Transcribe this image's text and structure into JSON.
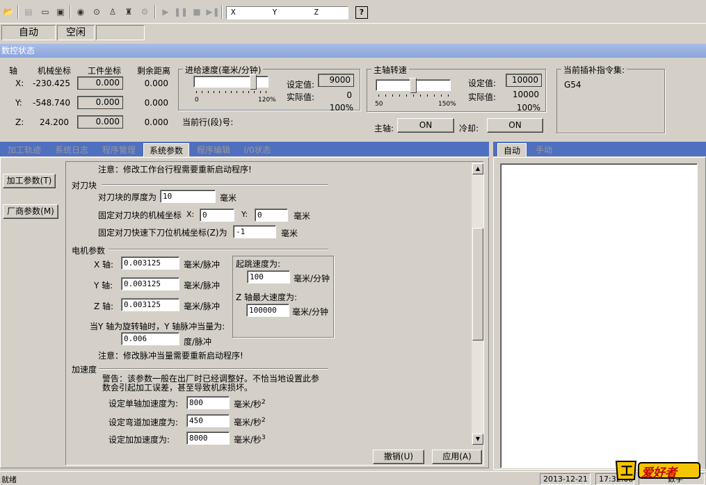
{
  "toolbar": {
    "coords_text": "X        Y        Z",
    "help_label": "?",
    "icons": [
      "open-icon",
      "new-program-icon",
      "window-icon",
      "program-view-icon",
      "sensor-icon",
      "probe-icon",
      "spindle-icon",
      "coolant-icon",
      "tool-icon",
      "run-icon",
      "pause-icon",
      "stop-icon",
      "step-icon"
    ]
  },
  "mode": {
    "run_mode": "自动",
    "state": "空闲"
  },
  "cnc_status": {
    "title": "数控状态",
    "headers": {
      "axis": "轴",
      "machine": "机械坐标",
      "work": "工件坐标",
      "remaining": "剩余距离"
    },
    "axes": [
      {
        "label": "X:",
        "machine": "-230.425",
        "work": "0.000",
        "remaining": "0.000"
      },
      {
        "label": "Y:",
        "machine": "-548.740",
        "work": "0.000",
        "remaining": "0.000"
      },
      {
        "label": "Z:",
        "machine": "24.200",
        "work": "0.000",
        "remaining": "0.000"
      }
    ],
    "feed": {
      "title": "进给速度(毫米/分钟)",
      "min_label": "0",
      "max_label": "120%",
      "set_label": "设定值:",
      "set_value": "9000",
      "actual_label": "实际值:",
      "actual_value": "0",
      "percent": "100%",
      "slider_level": 0.83
    },
    "current_line_label": "当前行(段)号:",
    "spindle": {
      "title": "主轴转速",
      "min_label": "50",
      "max_label": "150%",
      "set_label": "设定值:",
      "set_value": "10000",
      "actual_label": "实际值:",
      "actual_value": "10000",
      "percent": "100%",
      "slider_level": 0.5
    },
    "spindle_btn_label": "主轴:",
    "spindle_btn": "ON",
    "coolant_btn_label": "冷却:",
    "coolant_btn": "ON",
    "interp": {
      "title": "当前插补指令集:",
      "value": "G54"
    }
  },
  "left_tabs": [
    {
      "label": "加工轨迹",
      "active": false
    },
    {
      "label": "系统日志",
      "active": false
    },
    {
      "label": "程序管理",
      "active": false
    },
    {
      "label": "系统参数",
      "active": true
    },
    {
      "label": "程序编辑",
      "active": false
    },
    {
      "label": "I/0状态",
      "active": false
    }
  ],
  "side_buttons": {
    "process": "加工参数(T)",
    "vendor": "厂商参数(M)"
  },
  "params": {
    "notice_travel": "注意：修改工作台行程需要重新启动程序!",
    "tool_block": {
      "title": "对刀块",
      "thickness_label": "对刀块的厚度为",
      "thickness": "10",
      "thickness_unit": "毫米",
      "fixed_label": "固定对刀块的机械坐标",
      "x_label": "X:",
      "x_value": "0",
      "y_label": "Y:",
      "y_value": "0",
      "fixed_unit": "毫米",
      "fast_label": "固定对刀快速下刀位机械坐标(Z)为",
      "fast_value": "-1",
      "fast_unit": "毫米"
    },
    "motor": {
      "title": "电机参数",
      "x_label": "X 轴:",
      "x_value": "0.003125",
      "x_unit": "毫米/脉冲",
      "y_label": "Y 轴:",
      "y_value": "0.003125",
      "y_unit": "毫米/脉冲",
      "z_label": "Z 轴:",
      "z_value": "0.003125",
      "z_unit": "毫米/脉冲",
      "rotary_label": "当Y 轴为旋转轴时，Y 轴脉冲当量为:",
      "rotary_value": "0.006",
      "rotary_unit": "度/脉冲",
      "jump_label": "起跳速度为:",
      "jump_value": "100",
      "jump_unit": "毫米/分钟",
      "zmax_label": "Z 轴最大速度为:",
      "zmax_value": "100000",
      "zmax_unit": "毫米/分钟",
      "notice": "注意：修改脉冲当量需要重新启动程序!"
    },
    "accel": {
      "title": "加速度",
      "warn1": "警告：该参数一般在出厂时已经调整好。不恰当地设置此参",
      "warn2": "数会引起加工误差，甚至导致机床损坏。",
      "single_label": "设定单轴加速度为:",
      "single_value": "800",
      "single_unit": "毫米/秒",
      "single_sup": "2",
      "curve_label": "设定弯道加速度为:",
      "curve_value": "450",
      "curve_unit": "毫米/秒",
      "curve_sup": "2",
      "jerk_label": "设定加加速度为:",
      "jerk_value": "8000",
      "jerk_unit": "毫米/秒",
      "jerk_sup": "3"
    }
  },
  "actions": {
    "undo": "撤销(U)",
    "apply": "应用(A)"
  },
  "right_tabs": [
    {
      "label": "自动",
      "active": true
    },
    {
      "label": "手动",
      "active": false
    }
  ],
  "status_bar": {
    "ready": "就绪",
    "date": "2013-12-21",
    "time": "17:32:08",
    "num": "数字"
  },
  "watermark": "爱好者",
  "colors": {
    "title_bar": "#8aa4dc",
    "tab_bar": "#4f6fbf",
    "face": "#d4d0c8"
  }
}
